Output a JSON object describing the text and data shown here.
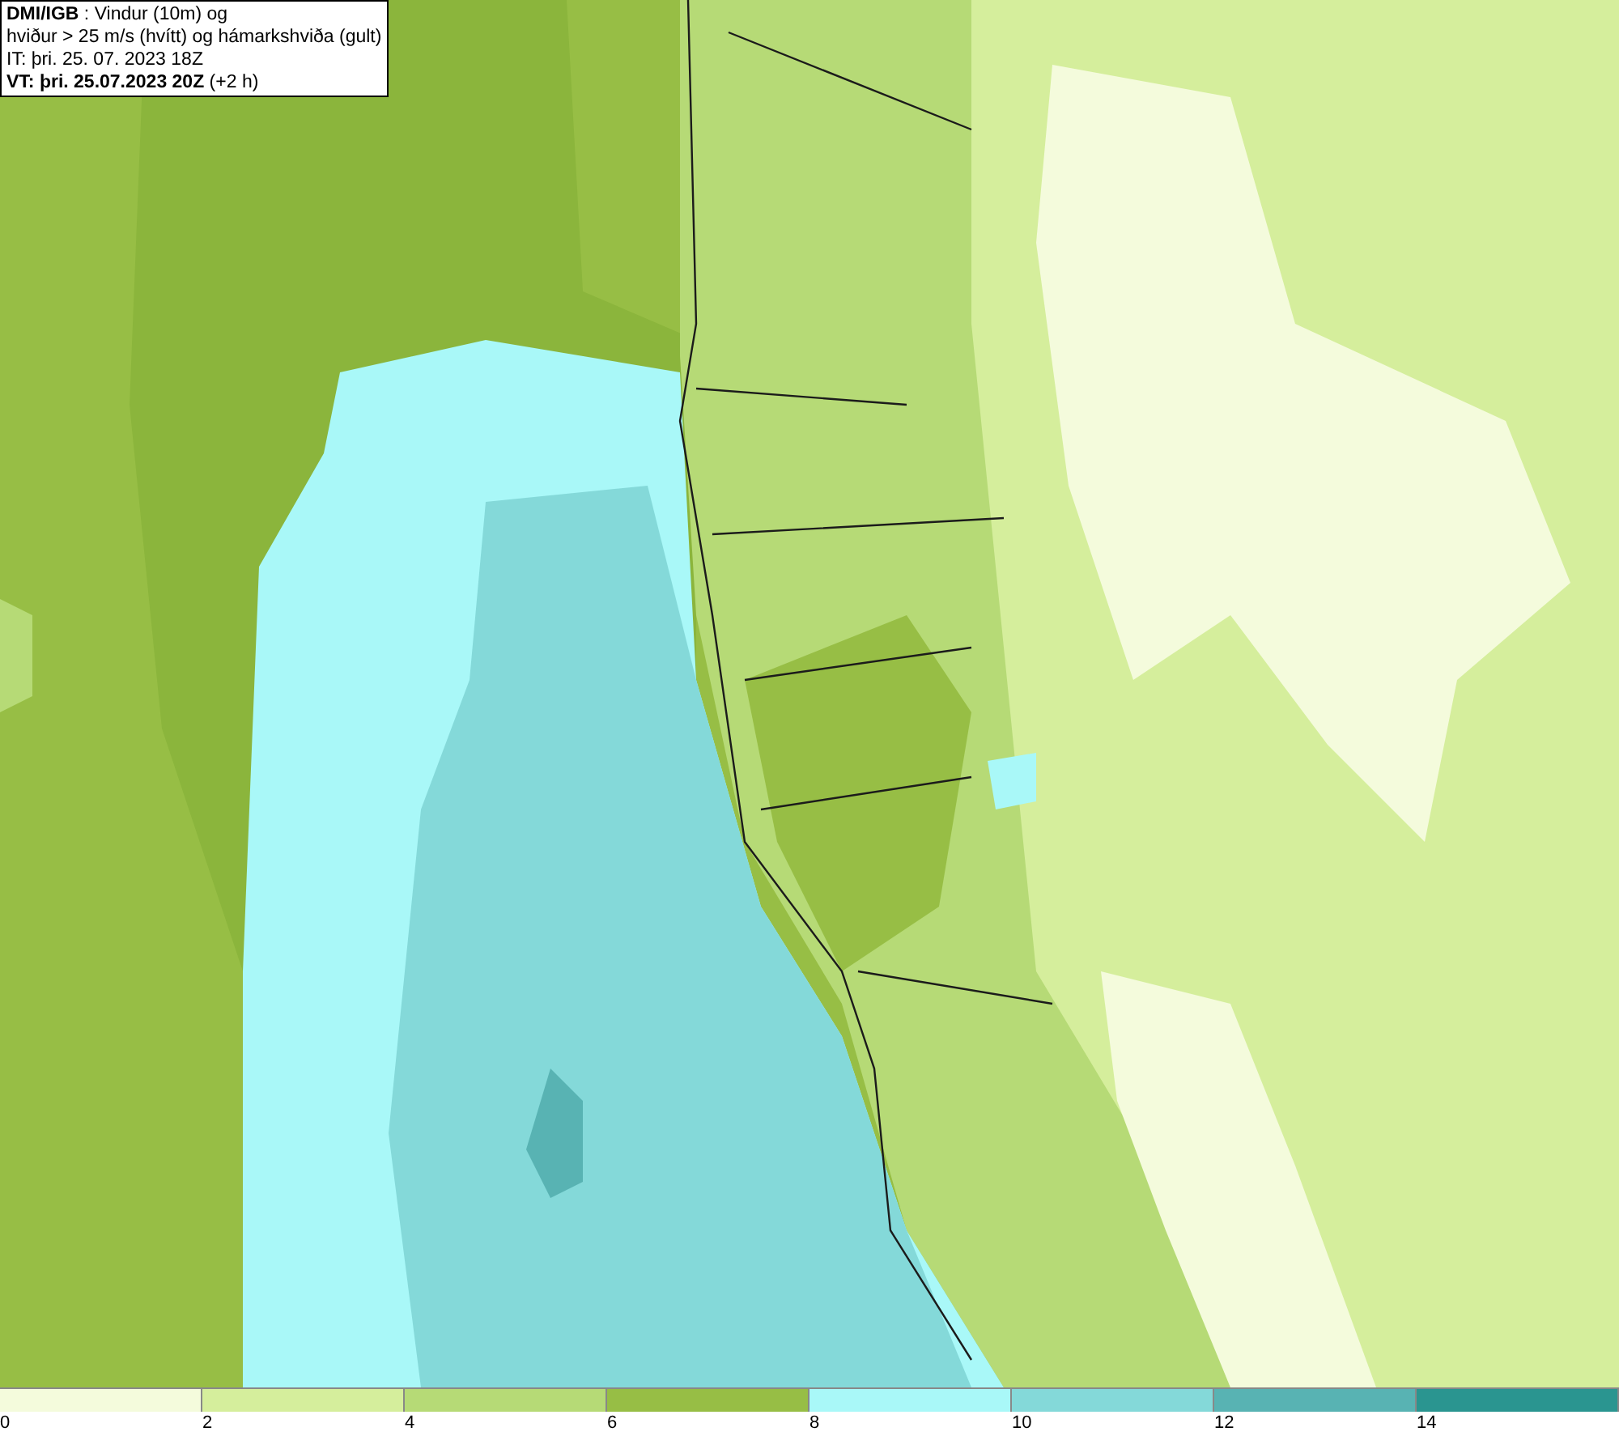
{
  "info_box": {
    "lines": [
      "**DMI/IGB** : Vindur (10m) og",
      "hviður > 25 m/s (hvítt) og hámarkshviða (gult)",
      "IT: þri. 25. 07. 2023 18Z",
      "**VT: þri. 25.07.2023 20Z** (+2 h)"
    ]
  },
  "legend": {
    "bins": [
      {
        "label": "0",
        "color": "#f4fbdc"
      },
      {
        "label": "2",
        "color": "#d5ee9c"
      },
      {
        "label": "4",
        "color": "#b6da76"
      },
      {
        "label": "6",
        "color": "#97be45"
      },
      {
        "label": "8",
        "color": "#a9f8f8"
      },
      {
        "label": "10",
        "color": "#84d9d9"
      },
      {
        "label": "12",
        "color": "#58b3b3"
      },
      {
        "label": "14",
        "color": "#2a9590"
      }
    ]
  }
}
